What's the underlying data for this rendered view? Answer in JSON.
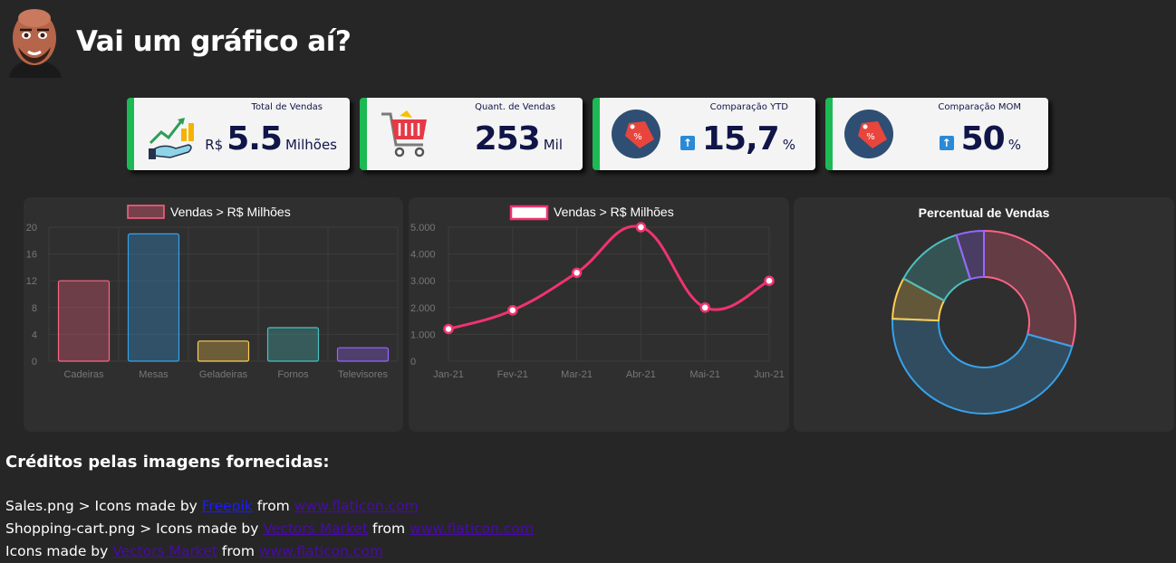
{
  "header": {
    "title": "Vai um gráfico aí?"
  },
  "cards": [
    {
      "label": "Total de Vendas",
      "prefix": "R$",
      "value": "5.5",
      "suffix": "Milhões",
      "icon": "sales-growth-icon"
    },
    {
      "label": "Quant. de Vendas",
      "prefix": "",
      "value": "253",
      "suffix": "Mil",
      "icon": "shopping-cart-icon"
    },
    {
      "label": "Comparação YTD",
      "prefix": "",
      "value": "15,7",
      "suffix": "%",
      "icon": "discount-tag-icon",
      "arrow": "↑"
    },
    {
      "label": "Comparação MOM",
      "prefix": "",
      "value": "50",
      "suffix": "%",
      "icon": "discount-tag-icon",
      "arrow": "↑"
    }
  ],
  "colors": {
    "card_accent": "#1db954",
    "card_text": "#101548",
    "line": "#f0336f",
    "background": "#262626",
    "panel": "#2f2f2f"
  },
  "chart_data": [
    {
      "type": "bar",
      "legend": "Vendas > R$ Milhões",
      "categories": [
        "Cadeiras",
        "Mesas",
        "Geladeiras",
        "Fornos",
        "Televisores"
      ],
      "series": [
        {
          "name": "Vendas > R$ Milhões",
          "values": [
            12,
            19,
            3,
            5,
            2
          ]
        }
      ],
      "colors": [
        "#ff6384",
        "#36a2eb",
        "#ffce56",
        "#4bc0c0",
        "#9966ff"
      ],
      "yticks": [
        "0",
        "4",
        "8",
        "12",
        "16",
        "20"
      ],
      "ylim": [
        0,
        20
      ],
      "grid": true
    },
    {
      "type": "line",
      "legend": "Vendas > R$ Milhões",
      "categories": [
        "Jan-21",
        "Fev-21",
        "Mar-21",
        "Abr-21",
        "Mai-21",
        "Jun-21"
      ],
      "series": [
        {
          "name": "Vendas > R$ Milhões",
          "values": [
            1200,
            1900,
            3300,
            5000,
            2000,
            3000
          ]
        }
      ],
      "yticks": [
        "0",
        "1.000",
        "2.000",
        "3.000",
        "4.000",
        "5.000"
      ],
      "ylim": [
        0,
        5000
      ],
      "grid": true
    },
    {
      "type": "pie",
      "title": "Percentual de Vendas",
      "values": [
        12,
        19,
        3,
        5,
        2
      ],
      "colors": [
        "#ff6384",
        "#36a2eb",
        "#ffce56",
        "#4bc0c0",
        "#9966ff"
      ]
    }
  ],
  "credits": {
    "title": "Créditos pelas imagens fornecidas:",
    "lines": [
      {
        "text": "Sales.png > Icons made by ",
        "author": "Freepik",
        "from": " from ",
        "site": "www.flaticon.com"
      },
      {
        "text": "Shopping-cart.png > Icons made by ",
        "author": "Vectors Market",
        "from": " from ",
        "site": "www.flaticon.com"
      },
      {
        "text": "Icons made by ",
        "author": "Vectors Market",
        "from": " from ",
        "site": "www.flaticon.com"
      }
    ]
  }
}
